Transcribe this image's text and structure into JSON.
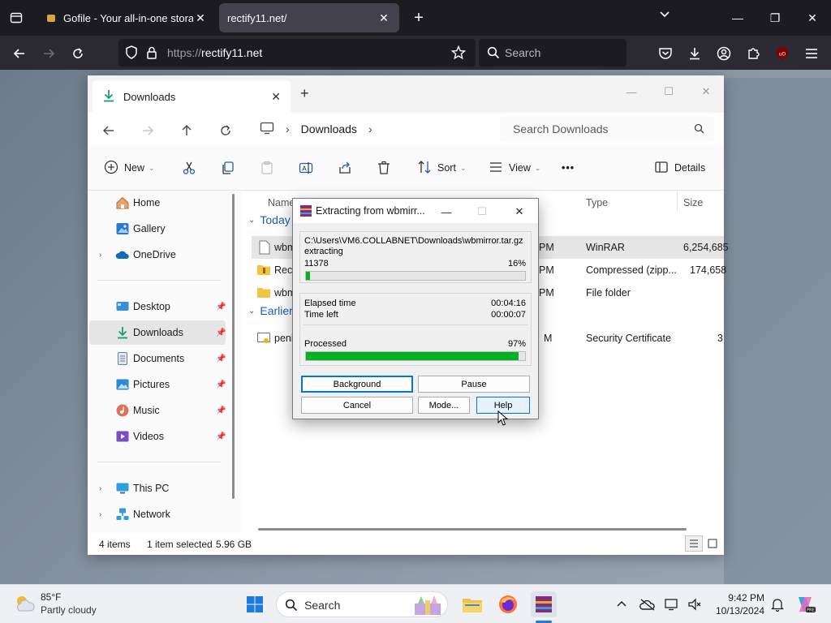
{
  "browser": {
    "tabs": [
      {
        "title": "Gofile - Your all-in-one storage",
        "active": false
      },
      {
        "title": "rectify11.net/",
        "active": true
      }
    ],
    "url_protocol": "https://",
    "url_host": "rectify11.net",
    "search_placeholder": "Search"
  },
  "explorer": {
    "tab_title": "Downloads",
    "breadcrumb": "Downloads",
    "search_placeholder": "Search Downloads",
    "toolbar": {
      "new": "New",
      "sort": "Sort",
      "view": "View",
      "more": "•••",
      "details": "Details"
    },
    "sidebar": {
      "top": [
        {
          "label": "Home"
        },
        {
          "label": "Gallery"
        },
        {
          "label": "OneDrive"
        }
      ],
      "pinned": [
        {
          "label": "Desktop"
        },
        {
          "label": "Downloads"
        },
        {
          "label": "Documents"
        },
        {
          "label": "Pictures"
        },
        {
          "label": "Music"
        },
        {
          "label": "Videos"
        }
      ],
      "bottom": [
        {
          "label": "This PC"
        },
        {
          "label": "Network"
        }
      ]
    },
    "columns": {
      "name": "Name",
      "type": "Type",
      "size": "Size"
    },
    "groups": {
      "today": "Today",
      "earlier": "Earlier"
    },
    "rows": [
      {
        "name": "wbm",
        "date_frag": "PM",
        "type": "WinRAR",
        "size": "6,254,685"
      },
      {
        "name": "Rect",
        "date_frag": "PM",
        "type": "Compressed (zipp...",
        "size": "174,658"
      },
      {
        "name": "wbm",
        "date_frag": "PM",
        "type": "File folder",
        "size": ""
      },
      {
        "name": "peni",
        "date_frag": "M",
        "type": "Security Certificate",
        "size": "3"
      }
    ],
    "status": {
      "items": "4 items",
      "selected": "1 item selected",
      "size": "5.96 GB"
    }
  },
  "dialog": {
    "title": "Extracting from wbmirr...",
    "path": "C:\\Users\\VM6.COLLABNET\\Downloads\\wbmirror.tar.gz",
    "action": "extracting",
    "file_count": "11378",
    "file_percent_label": "16%",
    "file_progress": 0.02,
    "elapsed_label": "Elapsed time",
    "elapsed": "00:04:16",
    "left_label": "Time left",
    "left": "00:00:07",
    "processed_label": "Processed",
    "processed_percent_label": "97%",
    "processed_progress": 0.97,
    "buttons": {
      "background": "Background",
      "pause": "Pause",
      "cancel": "Cancel",
      "mode": "Mode...",
      "help": "Help"
    }
  },
  "taskbar": {
    "temp": "85°F",
    "condition": "Partly cloudy",
    "search_placeholder": "Search",
    "time": "9:42 PM",
    "date": "10/13/2024"
  }
}
